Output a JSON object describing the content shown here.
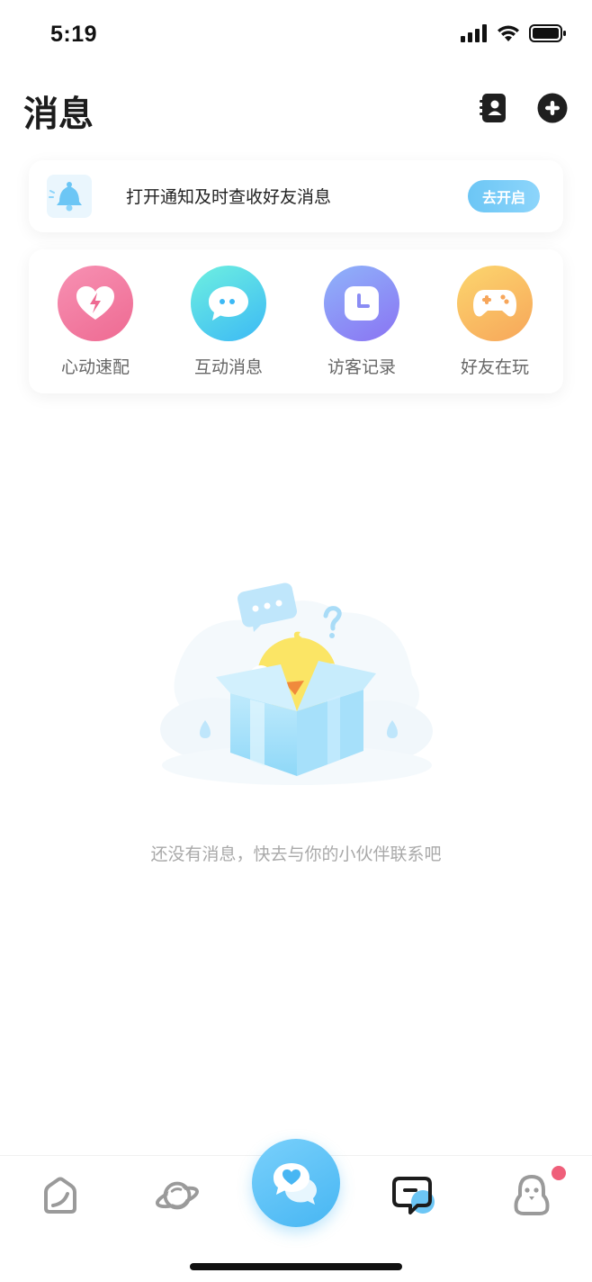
{
  "status_bar": {
    "time": "5:19"
  },
  "header": {
    "title": "消息"
  },
  "notify": {
    "text": "打开通知及时查收好友消息",
    "button": "去开启"
  },
  "features": [
    {
      "label": "心动速配",
      "icon": "heart-bolt-icon",
      "color_from": "#f791b3",
      "color_to": "#ee6a92"
    },
    {
      "label": "互动消息",
      "icon": "chat-bubble-icon",
      "color_from": "#6ef0e0",
      "color_to": "#3cb9f5"
    },
    {
      "label": "访客记录",
      "icon": "clock-icon",
      "color_from": "#8fb4fa",
      "color_to": "#8a73f3"
    },
    {
      "label": "好友在玩",
      "icon": "gamepad-icon",
      "color_from": "#fcd66e",
      "color_to": "#f7a65a"
    }
  ],
  "empty": {
    "text": "还没有消息，快去与你的小伙伴联系吧"
  },
  "tabs": [
    {
      "name": "home-icon"
    },
    {
      "name": "planet-icon"
    },
    {
      "name": "match-chat-icon"
    },
    {
      "name": "messages-icon"
    },
    {
      "name": "profile-icon"
    }
  ],
  "colors": {
    "accent": "#47b6f3",
    "badge": "#ef5f7a"
  }
}
